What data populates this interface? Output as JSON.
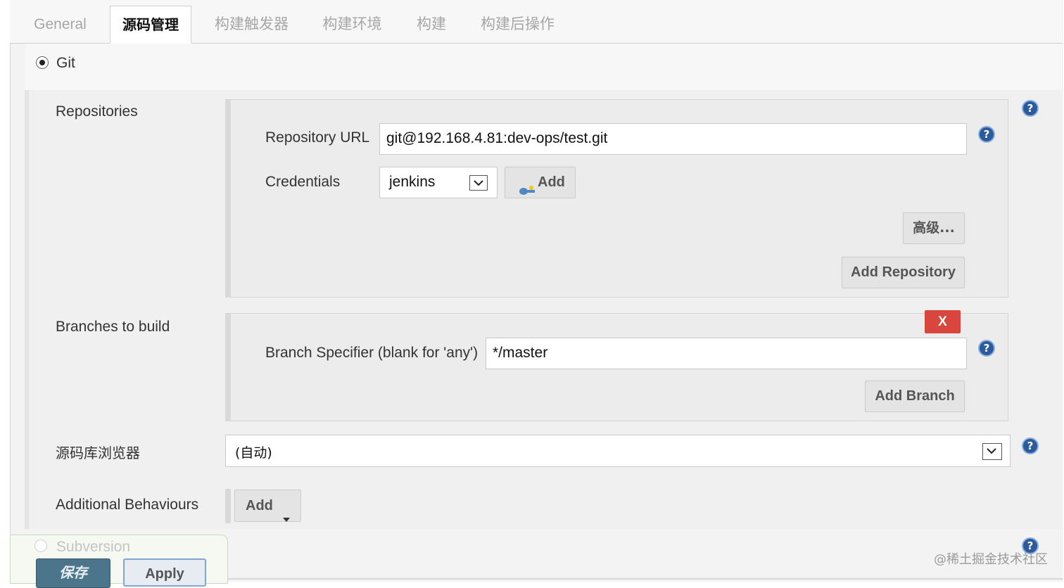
{
  "tabs": [
    {
      "label": "General"
    },
    {
      "label": "源码管理"
    },
    {
      "label": "构建触发器"
    },
    {
      "label": "构建环境"
    },
    {
      "label": "构建"
    },
    {
      "label": "构建后操作"
    }
  ],
  "scm": {
    "git_label": "Git",
    "subversion_label": "Subversion"
  },
  "repositories": {
    "label": "Repositories",
    "url_label": "Repository URL",
    "url_value": "git@192.168.4.81:dev-ops/test.git",
    "credentials_label": "Credentials",
    "credentials_value": "jenkins",
    "add_credentials_label": "Add",
    "advanced_label": "高级...",
    "add_repository_label": "Add Repository"
  },
  "branches": {
    "label": "Branches to build",
    "delete_label": "X",
    "specifier_label": "Branch Specifier (blank for 'any')",
    "specifier_value": "*/master",
    "add_branch_label": "Add Branch"
  },
  "browser": {
    "label": "源码库浏览器",
    "value": "(自动)"
  },
  "behaviours": {
    "label": "Additional Behaviours",
    "add_label": "Add"
  },
  "footer": {
    "save_label": "保存",
    "apply_label": "Apply"
  },
  "watermark": "@稀土掘金技术社区",
  "colors": {
    "help_icon": "#2a5b9c",
    "delete_button": "#d9463d",
    "save_button": "#4b758b"
  }
}
